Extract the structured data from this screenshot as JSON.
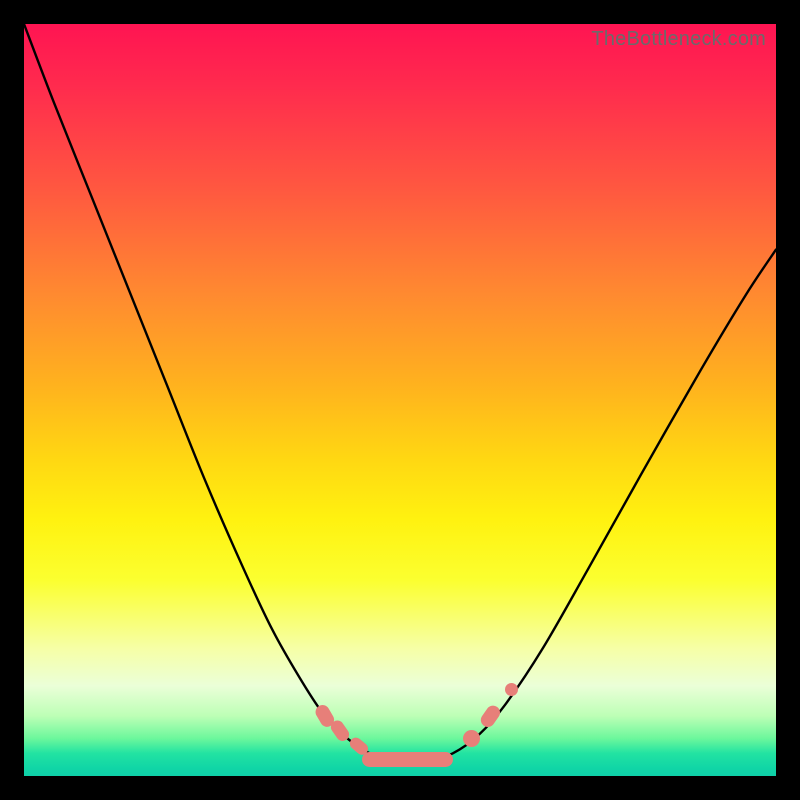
{
  "watermark": "TheBottleneck.com",
  "colors": {
    "frame": "#000000",
    "curve": "#000000",
    "marker": "#e77f79"
  },
  "chart_data": {
    "type": "line",
    "title": "",
    "xlabel": "",
    "ylabel": "",
    "xlim": [
      0,
      1
    ],
    "ylim": [
      0,
      1
    ],
    "note": "Axes are unlabeled; values are normalized plot-area fractions (x right, y up).",
    "series": [
      {
        "name": "v-curve",
        "x": [
          0.0,
          0.04,
          0.09,
          0.14,
          0.19,
          0.24,
          0.29,
          0.33,
          0.37,
          0.4,
          0.43,
          0.46,
          0.485,
          0.51,
          0.54,
          0.57,
          0.605,
          0.64,
          0.69,
          0.75,
          0.82,
          0.9,
          0.96,
          1.0
        ],
        "y": [
          1.0,
          0.895,
          0.77,
          0.645,
          0.52,
          0.395,
          0.28,
          0.195,
          0.125,
          0.08,
          0.05,
          0.03,
          0.022,
          0.02,
          0.022,
          0.03,
          0.055,
          0.095,
          0.17,
          0.275,
          0.4,
          0.54,
          0.64,
          0.7
        ]
      }
    ],
    "markers": [
      {
        "name": "left-cluster-top",
        "cx": 0.4,
        "cy": 0.08,
        "r": 0.012,
        "shape": "pill",
        "angle_deg": 60
      },
      {
        "name": "left-cluster-mid",
        "cx": 0.42,
        "cy": 0.06,
        "r": 0.011,
        "shape": "pill",
        "angle_deg": 55
      },
      {
        "name": "left-cluster-low",
        "cx": 0.445,
        "cy": 0.04,
        "r": 0.01,
        "shape": "pill",
        "angle_deg": 40
      },
      {
        "name": "bottom-bar",
        "cx": 0.51,
        "cy": 0.022,
        "r": 0.01,
        "shape": "hbar",
        "w": 0.12
      },
      {
        "name": "right-dot-low",
        "cx": 0.595,
        "cy": 0.05,
        "r": 0.011,
        "shape": "dot"
      },
      {
        "name": "right-pill-mid",
        "cx": 0.62,
        "cy": 0.08,
        "r": 0.012,
        "shape": "pill",
        "angle_deg": -55
      },
      {
        "name": "right-dot-high",
        "cx": 0.648,
        "cy": 0.115,
        "r": 0.009,
        "shape": "dot"
      }
    ]
  }
}
